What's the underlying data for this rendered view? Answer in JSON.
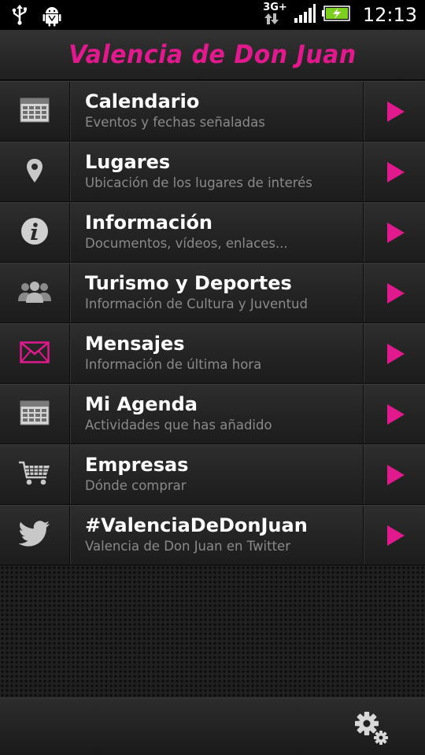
{
  "status_bar": {
    "time": "12:13",
    "network": "3G+",
    "icons": [
      "usb-icon",
      "android-debug-icon",
      "data-arrows-icon",
      "signal-icon",
      "battery-charging-icon"
    ]
  },
  "header": {
    "title": "Valencia de Don Juan"
  },
  "menu": [
    {
      "title": "Calendario",
      "subtitle": "Eventos y fechas señaladas",
      "icon": "calendar-icon"
    },
    {
      "title": "Lugares",
      "subtitle": "Ubicación de los lugares de interés",
      "icon": "location-pin-icon"
    },
    {
      "title": "Información",
      "subtitle": "Documentos, vídeos, enlaces...",
      "icon": "info-icon"
    },
    {
      "title": "Turismo y Deportes",
      "subtitle": "Información de Cultura y Juventud",
      "icon": "people-icon"
    },
    {
      "title": "Mensajes",
      "subtitle": "Información de última hora",
      "icon": "envelope-icon"
    },
    {
      "title": "Mi Agenda",
      "subtitle": "Actividades que has añadido",
      "icon": "calendar-icon"
    },
    {
      "title": "Empresas",
      "subtitle": "Dónde comprar",
      "icon": "shopping-cart-icon"
    },
    {
      "title": "#ValenciaDeDonJuan",
      "subtitle": "Valencia de Don Juan en Twitter",
      "icon": "twitter-bird-icon"
    }
  ],
  "footer": {
    "settings_icon": "settings-gears-icon"
  },
  "colors": {
    "accent": "#e0198c",
    "background": "#141414",
    "title_text": "#ffffff",
    "subtitle_text": "#8a8a8a"
  }
}
